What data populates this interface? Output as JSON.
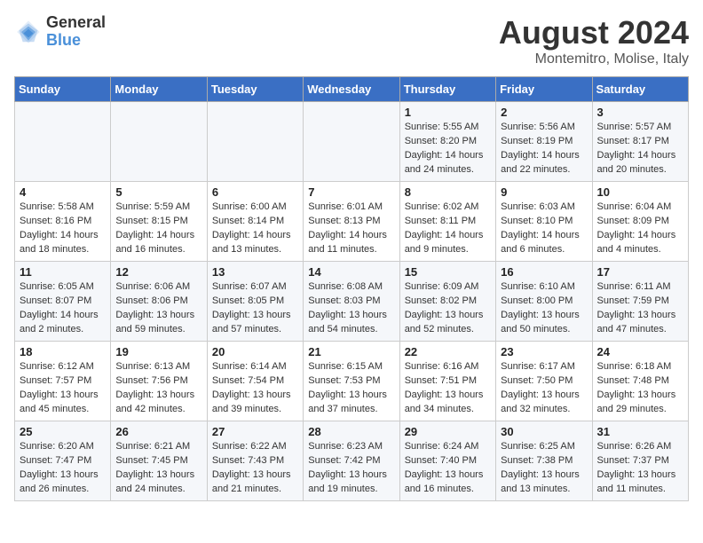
{
  "header": {
    "logo_line1": "General",
    "logo_line2": "Blue",
    "main_title": "August 2024",
    "subtitle": "Montemitro, Molise, Italy"
  },
  "weekdays": [
    "Sunday",
    "Monday",
    "Tuesday",
    "Wednesday",
    "Thursday",
    "Friday",
    "Saturday"
  ],
  "weeks": [
    [
      {
        "day": "",
        "info": ""
      },
      {
        "day": "",
        "info": ""
      },
      {
        "day": "",
        "info": ""
      },
      {
        "day": "",
        "info": ""
      },
      {
        "day": "1",
        "info": "Sunrise: 5:55 AM\nSunset: 8:20 PM\nDaylight: 14 hours\nand 24 minutes."
      },
      {
        "day": "2",
        "info": "Sunrise: 5:56 AM\nSunset: 8:19 PM\nDaylight: 14 hours\nand 22 minutes."
      },
      {
        "day": "3",
        "info": "Sunrise: 5:57 AM\nSunset: 8:17 PM\nDaylight: 14 hours\nand 20 minutes."
      }
    ],
    [
      {
        "day": "4",
        "info": "Sunrise: 5:58 AM\nSunset: 8:16 PM\nDaylight: 14 hours\nand 18 minutes."
      },
      {
        "day": "5",
        "info": "Sunrise: 5:59 AM\nSunset: 8:15 PM\nDaylight: 14 hours\nand 16 minutes."
      },
      {
        "day": "6",
        "info": "Sunrise: 6:00 AM\nSunset: 8:14 PM\nDaylight: 14 hours\nand 13 minutes."
      },
      {
        "day": "7",
        "info": "Sunrise: 6:01 AM\nSunset: 8:13 PM\nDaylight: 14 hours\nand 11 minutes."
      },
      {
        "day": "8",
        "info": "Sunrise: 6:02 AM\nSunset: 8:11 PM\nDaylight: 14 hours\nand 9 minutes."
      },
      {
        "day": "9",
        "info": "Sunrise: 6:03 AM\nSunset: 8:10 PM\nDaylight: 14 hours\nand 6 minutes."
      },
      {
        "day": "10",
        "info": "Sunrise: 6:04 AM\nSunset: 8:09 PM\nDaylight: 14 hours\nand 4 minutes."
      }
    ],
    [
      {
        "day": "11",
        "info": "Sunrise: 6:05 AM\nSunset: 8:07 PM\nDaylight: 14 hours\nand 2 minutes."
      },
      {
        "day": "12",
        "info": "Sunrise: 6:06 AM\nSunset: 8:06 PM\nDaylight: 13 hours\nand 59 minutes."
      },
      {
        "day": "13",
        "info": "Sunrise: 6:07 AM\nSunset: 8:05 PM\nDaylight: 13 hours\nand 57 minutes."
      },
      {
        "day": "14",
        "info": "Sunrise: 6:08 AM\nSunset: 8:03 PM\nDaylight: 13 hours\nand 54 minutes."
      },
      {
        "day": "15",
        "info": "Sunrise: 6:09 AM\nSunset: 8:02 PM\nDaylight: 13 hours\nand 52 minutes."
      },
      {
        "day": "16",
        "info": "Sunrise: 6:10 AM\nSunset: 8:00 PM\nDaylight: 13 hours\nand 50 minutes."
      },
      {
        "day": "17",
        "info": "Sunrise: 6:11 AM\nSunset: 7:59 PM\nDaylight: 13 hours\nand 47 minutes."
      }
    ],
    [
      {
        "day": "18",
        "info": "Sunrise: 6:12 AM\nSunset: 7:57 PM\nDaylight: 13 hours\nand 45 minutes."
      },
      {
        "day": "19",
        "info": "Sunrise: 6:13 AM\nSunset: 7:56 PM\nDaylight: 13 hours\nand 42 minutes."
      },
      {
        "day": "20",
        "info": "Sunrise: 6:14 AM\nSunset: 7:54 PM\nDaylight: 13 hours\nand 39 minutes."
      },
      {
        "day": "21",
        "info": "Sunrise: 6:15 AM\nSunset: 7:53 PM\nDaylight: 13 hours\nand 37 minutes."
      },
      {
        "day": "22",
        "info": "Sunrise: 6:16 AM\nSunset: 7:51 PM\nDaylight: 13 hours\nand 34 minutes."
      },
      {
        "day": "23",
        "info": "Sunrise: 6:17 AM\nSunset: 7:50 PM\nDaylight: 13 hours\nand 32 minutes."
      },
      {
        "day": "24",
        "info": "Sunrise: 6:18 AM\nSunset: 7:48 PM\nDaylight: 13 hours\nand 29 minutes."
      }
    ],
    [
      {
        "day": "25",
        "info": "Sunrise: 6:20 AM\nSunset: 7:47 PM\nDaylight: 13 hours\nand 26 minutes."
      },
      {
        "day": "26",
        "info": "Sunrise: 6:21 AM\nSunset: 7:45 PM\nDaylight: 13 hours\nand 24 minutes."
      },
      {
        "day": "27",
        "info": "Sunrise: 6:22 AM\nSunset: 7:43 PM\nDaylight: 13 hours\nand 21 minutes."
      },
      {
        "day": "28",
        "info": "Sunrise: 6:23 AM\nSunset: 7:42 PM\nDaylight: 13 hours\nand 19 minutes."
      },
      {
        "day": "29",
        "info": "Sunrise: 6:24 AM\nSunset: 7:40 PM\nDaylight: 13 hours\nand 16 minutes."
      },
      {
        "day": "30",
        "info": "Sunrise: 6:25 AM\nSunset: 7:38 PM\nDaylight: 13 hours\nand 13 minutes."
      },
      {
        "day": "31",
        "info": "Sunrise: 6:26 AM\nSunset: 7:37 PM\nDaylight: 13 hours\nand 11 minutes."
      }
    ]
  ]
}
